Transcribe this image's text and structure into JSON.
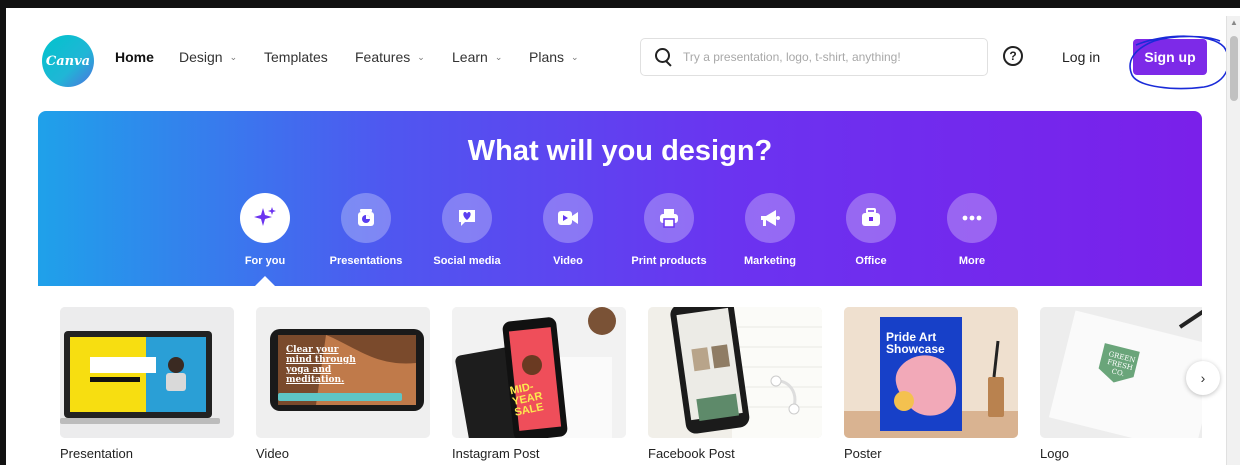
{
  "brand": {
    "logo_text": "Canva",
    "accent": "#7d2ae8",
    "teal": "#00c4cc"
  },
  "nav": {
    "home": "Home",
    "design": "Design",
    "templates": "Templates",
    "features": "Features",
    "learn": "Learn",
    "plans": "Plans",
    "search_placeholder": "Try a presentation, logo, t-shirt, anything!",
    "help": "?",
    "login": "Log in",
    "signup": "Sign up"
  },
  "hero": {
    "title": "What will you design?",
    "categories": [
      {
        "label": "For you",
        "icon": "sparkle-icon"
      },
      {
        "label": "Presentations",
        "icon": "presentation-icon"
      },
      {
        "label": "Social media",
        "icon": "heart-chat-icon"
      },
      {
        "label": "Video",
        "icon": "video-camera-icon"
      },
      {
        "label": "Print products",
        "icon": "printer-icon"
      },
      {
        "label": "Marketing",
        "icon": "megaphone-icon"
      },
      {
        "label": "Office",
        "icon": "briefcase-icon"
      },
      {
        "label": "More",
        "icon": "more-dots-icon"
      }
    ]
  },
  "cards": [
    {
      "title": "Presentation"
    },
    {
      "title": "Video",
      "thumb_text": "Clear your mind through yoga and meditation."
    },
    {
      "title": "Instagram Post",
      "thumb_text": "MID-YEAR SALE"
    },
    {
      "title": "Facebook Post"
    },
    {
      "title": "Poster",
      "thumb_text": "Pride Art Showcase"
    },
    {
      "title": "Logo",
      "thumb_text": "GREEN FRESH CO."
    }
  ],
  "carousel": {
    "next": "›"
  }
}
